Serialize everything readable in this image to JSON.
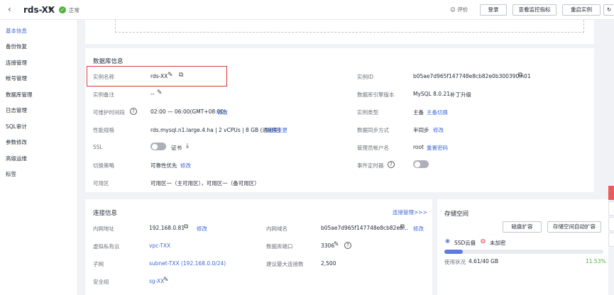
{
  "header": {
    "title": "rds-XX",
    "status": "正常",
    "rate_label": "评价",
    "login_button": "登录",
    "monitor_button": "查看监控指标",
    "restart_button": "重启实例"
  },
  "sidebar": {
    "items": [
      {
        "label": "基本信息",
        "active": true
      },
      {
        "label": "备份恢复"
      },
      {
        "label": "连接管理"
      },
      {
        "label": "帐号管理"
      },
      {
        "label": "数据库管理"
      },
      {
        "label": "日志管理"
      },
      {
        "label": "SQL审计"
      },
      {
        "label": "参数修改"
      },
      {
        "label": "高级运维"
      },
      {
        "label": "标签"
      }
    ]
  },
  "db_info": {
    "section_title": "数据库信息",
    "instance_name_label": "实例名称",
    "instance_name": "rds-XX",
    "instance_note_label": "实例备注",
    "instance_note": "--",
    "maintenance_label": "可维护时间段",
    "maintenance_value": "02:00 — 06:00(GMT+08:00)",
    "modify": "修改",
    "spec_label": "性能规格",
    "spec_value": "rds.mysql.n1.large.4.ha | 2 vCPUs | 8 GB (通用型)",
    "spec_change": "规格变更",
    "ssl_label": "SSL",
    "cert_label": "证书",
    "switch_strategy_label": "切换策略",
    "switch_strategy_value": "可靠性优先",
    "az_label": "可用区",
    "az_value": "可用区一（主可用区），可用区一（备可用区）",
    "instance_id_label": "实例ID",
    "instance_id": "b05ae7d965f147748e8cb82e0b300390in01",
    "engine_label": "数据库引擎版本",
    "engine_value": "MySQL 8.0.21",
    "upgrade": "补丁升级",
    "type_label": "实例类型",
    "type_value": "主备",
    "switchover": "主备切换",
    "sync_label": "数据同步方式",
    "sync_value": "半同步",
    "admin_label": "管理员帐户名",
    "admin_value": "root",
    "reset_password": "重置密码",
    "event_scheduler_label": "事件定时器"
  },
  "conn_info": {
    "section_title": "连接信息",
    "conn_mgmt_link": "连接管理>>>",
    "private_ip_label": "内网地址",
    "private_ip": "192.168.0.81",
    "vpc_label": "虚拟私有云",
    "vpc": "vpc-TXX",
    "subnet_label": "子网",
    "subnet": "subnet-TXX (192.168.0.0/24)",
    "sg_label": "安全组",
    "sg": "sg-XX",
    "domain_label": "内网域名",
    "domain": "b05ae7d965f147748e8cb82e0...",
    "port_label": "数据库端口",
    "port": "3306",
    "max_conn_label": "建议最大连接数",
    "max_conn": "2,500",
    "modify": "修改"
  },
  "storage": {
    "section_title": "存储空间",
    "expand_button": "磁盘扩容",
    "auto_expand_button": "存储空间自动扩容",
    "disk_type": "SSD云盘",
    "encryption": "未加密",
    "usage_label": "使用状况",
    "usage_value": "4.61/40 GB",
    "usage_percent_text": "11.53%",
    "usage_fraction": 0.1153,
    "accent_color": "#5e7ce0",
    "success_color": "#50b33b"
  }
}
